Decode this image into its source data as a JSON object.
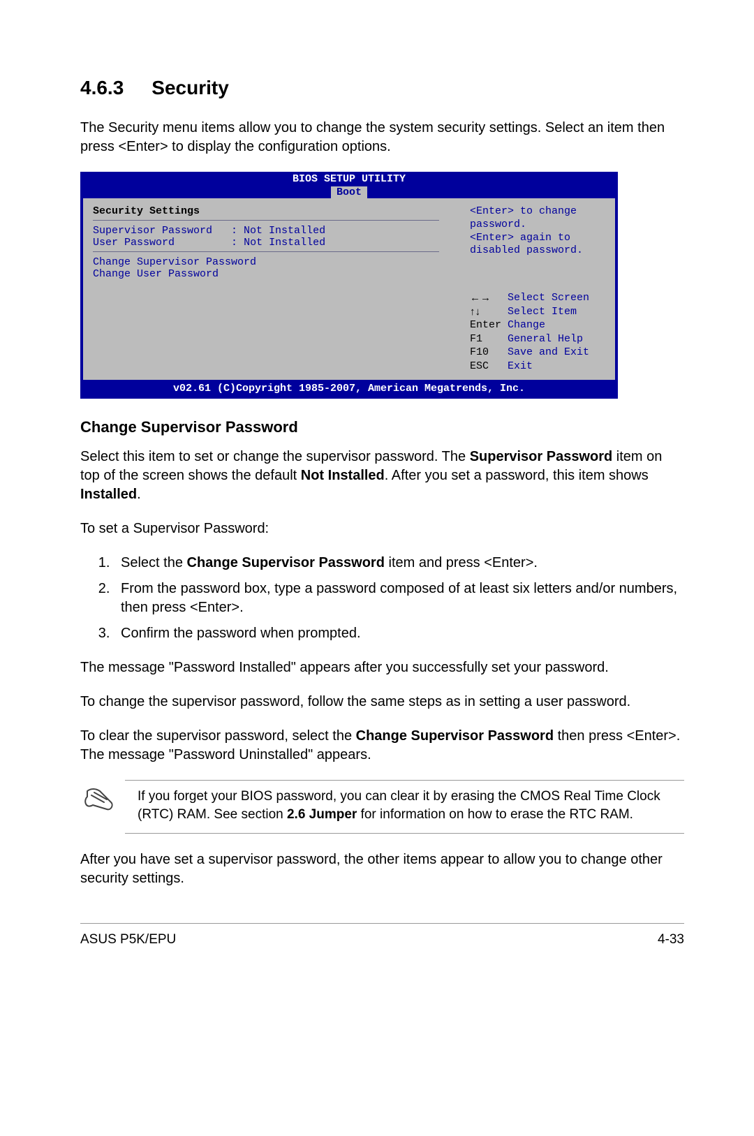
{
  "section": {
    "number": "4.6.3",
    "title": "Security"
  },
  "intro": "The Security menu items allow you to change the system security settings. Select an item then press <Enter> to display the configuration options.",
  "bios": {
    "utility_title": "BIOS SETUP UTILITY",
    "tab": "Boot",
    "left_heading": "Security Settings",
    "sup_label": "Supervisor Password",
    "sup_value": "Not Installed",
    "user_label": "User Password",
    "user_value": "Not Installed",
    "change_sup": "Change Supervisor Password",
    "change_user": "Change User Password",
    "hint_line1": "<Enter> to change password.",
    "hint_line2": "<Enter> again to disabled password.",
    "nav": {
      "screen": "Select Screen",
      "item": "Select Item",
      "enter_key": "Enter",
      "enter_lbl": "Change",
      "f1_key": "F1",
      "f1_lbl": "General Help",
      "f10_key": "F10",
      "f10_lbl": "Save and Exit",
      "esc_key": "ESC",
      "esc_lbl": "Exit"
    },
    "footer": "v02.61 (C)Copyright 1985-2007, American Megatrends, Inc."
  },
  "sub_heading": "Change Supervisor Password",
  "para1_a": "Select this item to set or change the supervisor password. The ",
  "para1_b": "Supervisor Password",
  "para1_c": " item on top of the screen shows the default ",
  "para1_d": "Not Installed",
  "para1_e": ". After you set a password, this item shows ",
  "para1_f": "Installed",
  "para1_g": ".",
  "para2": "To set a Supervisor Password:",
  "ol": {
    "i1a": "Select the ",
    "i1b": "Change Supervisor Password",
    "i1c": " item and press <Enter>.",
    "i2": "From the password box, type a password composed of at least six letters and/or numbers, then press <Enter>.",
    "i3": "Confirm the password when prompted."
  },
  "para3": "The message \"Password Installed\" appears after you successfully set your password.",
  "para4": "To change the supervisor password, follow the same steps as in setting a user password.",
  "para5_a": "To clear the supervisor password, select the ",
  "para5_b": "Change Supervisor Password",
  "para5_c": " then press <Enter>. The message \"Password Uninstalled\" appears.",
  "note_a": "If you forget your BIOS password, you can clear it by erasing the CMOS Real Time Clock (RTC) RAM. See section ",
  "note_b": "2.6 Jumper",
  "note_c": " for information on how to erase the RTC RAM.",
  "para6": "After you have set a supervisor password, the other items appear to allow you to change other security settings.",
  "footer_left": "ASUS P5K/EPU",
  "footer_right": "4-33"
}
